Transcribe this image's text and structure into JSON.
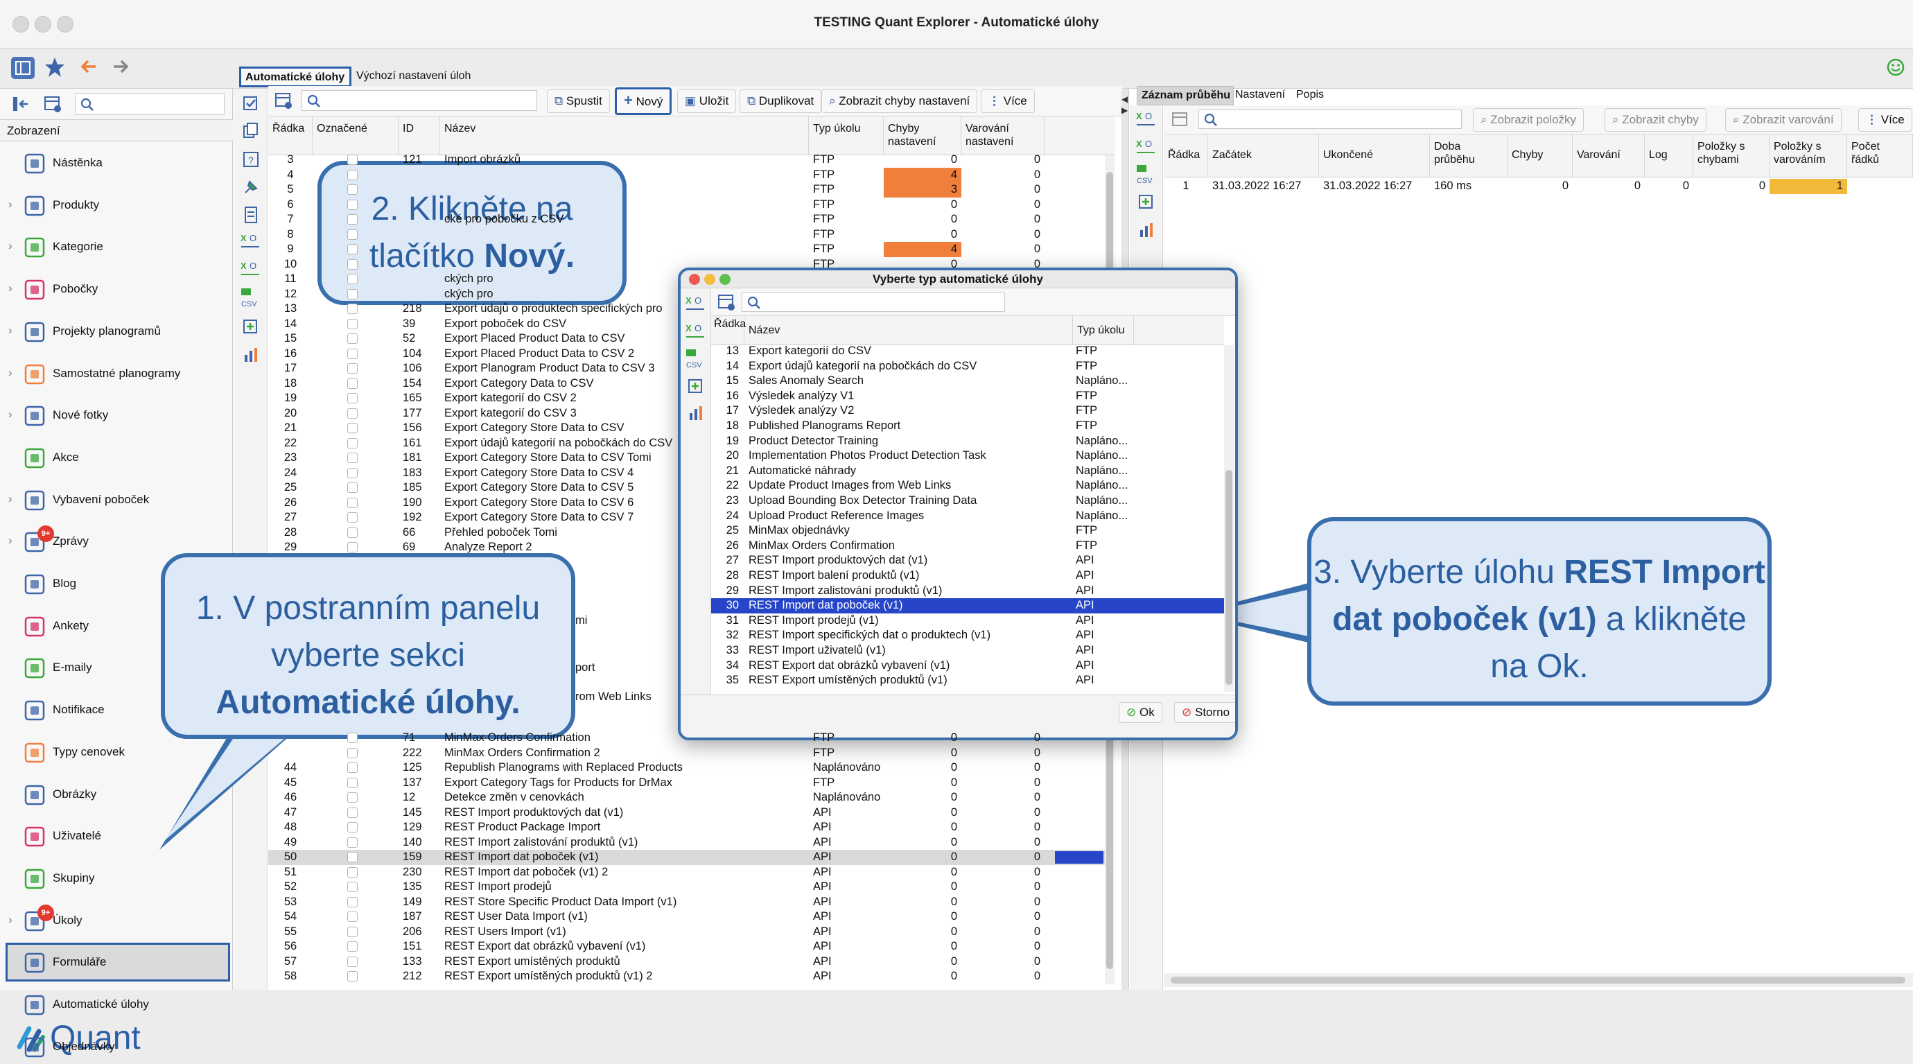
{
  "window": {
    "title": "TESTING Quant Explorer - Automatické úlohy"
  },
  "sidebar": {
    "section_label": "Zobrazení",
    "items": [
      {
        "label": "Nástěnka",
        "icon": "dashboard-icon",
        "chevron": false,
        "badge": ""
      },
      {
        "label": "Produkty",
        "icon": "product-icon",
        "chevron": true,
        "badge": ""
      },
      {
        "label": "Kategorie",
        "icon": "category-icon",
        "chevron": true,
        "badge": ""
      },
      {
        "label": "Pobočky",
        "icon": "store-icon",
        "chevron": true,
        "badge": ""
      },
      {
        "label": "Projekty planogramů",
        "icon": "planogram-project-icon",
        "chevron": true,
        "badge": ""
      },
      {
        "label": "Samostatné planogramy",
        "icon": "planogram-icon",
        "chevron": true,
        "badge": ""
      },
      {
        "label": "Nové fotky",
        "icon": "camera-icon",
        "chevron": true,
        "badge": ""
      },
      {
        "label": "Akce",
        "icon": "promo-icon",
        "chevron": false,
        "badge": ""
      },
      {
        "label": "Vybavení poboček",
        "icon": "equipment-icon",
        "chevron": true,
        "badge": ""
      },
      {
        "label": "Zprávy",
        "icon": "message-icon",
        "chevron": true,
        "badge": "9+"
      },
      {
        "label": "Blog",
        "icon": "blog-icon",
        "chevron": false,
        "badge": ""
      },
      {
        "label": "Ankety",
        "icon": "survey-icon",
        "chevron": false,
        "badge": ""
      },
      {
        "label": "E-maily",
        "icon": "mail-icon",
        "chevron": false,
        "badge": ""
      },
      {
        "label": "Notifikace",
        "icon": "notification-icon",
        "chevron": false,
        "badge": ""
      },
      {
        "label": "Typy cenovek",
        "icon": "price-tag-icon",
        "chevron": false,
        "badge": ""
      },
      {
        "label": "Obrázky",
        "icon": "image-icon",
        "chevron": false,
        "badge": ""
      },
      {
        "label": "Uživatelé",
        "icon": "user-icon",
        "chevron": false,
        "badge": ""
      },
      {
        "label": "Skupiny",
        "icon": "group-icon",
        "chevron": false,
        "badge": ""
      },
      {
        "label": "Úkoly",
        "icon": "task-icon",
        "chevron": true,
        "badge": "9+"
      },
      {
        "label": "Formuláře",
        "icon": "form-icon",
        "chevron": false,
        "badge": ""
      },
      {
        "label": "Automatické úlohy",
        "icon": "automatic-task-icon",
        "chevron": false,
        "badge": ""
      },
      {
        "label": "Objednávky",
        "icon": "order-icon",
        "chevron": false,
        "badge": ""
      }
    ],
    "logo_text": "Quant"
  },
  "main": {
    "tabs": [
      "Automatické úlohy",
      "Výchozí nastavení úloh"
    ],
    "toolbar": {
      "run_label": "Spustit",
      "new_label": "Nový",
      "save_label": "Uložit",
      "duplicate_label": "Duplikovat",
      "show_errors_label": "Zobrazit chyby nastavení",
      "more_label": "Více"
    },
    "columns": [
      "Řádka",
      "Označené",
      "ID",
      "Název",
      "Typ úkolu",
      "Chyby nastavení",
      "Varování nastavení"
    ],
    "rows": [
      {
        "n": "3",
        "id": "121",
        "name": "Import obrázků",
        "type": "FTP",
        "err": "0",
        "warn": "0"
      },
      {
        "n": "4",
        "id": "",
        "name": "",
        "type": "FTP",
        "err": "4",
        "warn": "0"
      },
      {
        "n": "5",
        "id": "",
        "name": "",
        "type": "FTP",
        "err": "3",
        "warn": "0"
      },
      {
        "n": "6",
        "id": "",
        "name": "",
        "type": "FTP",
        "err": "0",
        "warn": "0"
      },
      {
        "n": "7",
        "id": "",
        "name": "cké pro pobočku z CSV",
        "type": "FTP",
        "err": "0",
        "warn": "0"
      },
      {
        "n": "8",
        "id": "",
        "name": "",
        "type": "FTP",
        "err": "0",
        "warn": "0"
      },
      {
        "n": "9",
        "id": "",
        "name": "",
        "type": "FTP",
        "err": "4",
        "warn": "0"
      },
      {
        "n": "10",
        "id": "",
        "name": "",
        "type": "FTP",
        "err": "0",
        "warn": "0"
      },
      {
        "n": "11",
        "id": "",
        "name": "ckých pro",
        "type": "",
        "err": "",
        "warn": ""
      },
      {
        "n": "12",
        "id": "",
        "name": "ckých pro",
        "type": "",
        "err": "",
        "warn": ""
      },
      {
        "n": "13",
        "id": "218",
        "name": "Export údajů o produktech specifických pro",
        "type": "",
        "err": "",
        "warn": ""
      },
      {
        "n": "14",
        "id": "39",
        "name": "Export poboček do CSV",
        "type": "",
        "err": "",
        "warn": ""
      },
      {
        "n": "15",
        "id": "52",
        "name": "Export Placed Product Data to CSV",
        "type": "",
        "err": "",
        "warn": ""
      },
      {
        "n": "16",
        "id": "104",
        "name": "Export Placed Product Data to CSV 2",
        "type": "",
        "err": "",
        "warn": ""
      },
      {
        "n": "17",
        "id": "106",
        "name": "Export Planogram Product Data to CSV 3",
        "type": "",
        "err": "",
        "warn": ""
      },
      {
        "n": "18",
        "id": "154",
        "name": "Export Category Data to CSV",
        "type": "",
        "err": "",
        "warn": ""
      },
      {
        "n": "19",
        "id": "165",
        "name": "Export kategorií do CSV 2",
        "type": "",
        "err": "",
        "warn": ""
      },
      {
        "n": "20",
        "id": "177",
        "name": "Export kategorií do CSV 3",
        "type": "",
        "err": "",
        "warn": ""
      },
      {
        "n": "21",
        "id": "156",
        "name": "Export Category Store Data to CSV",
        "type": "",
        "err": "",
        "warn": ""
      },
      {
        "n": "22",
        "id": "161",
        "name": "Export údajů kategorií na pobočkách do CSV",
        "type": "",
        "err": "",
        "warn": ""
      },
      {
        "n": "23",
        "id": "181",
        "name": "Export Category Store Data to CSV Tomi",
        "type": "",
        "err": "",
        "warn": ""
      },
      {
        "n": "24",
        "id": "183",
        "name": "Export Category Store Data to CSV 4",
        "type": "",
        "err": "",
        "warn": ""
      },
      {
        "n": "25",
        "id": "185",
        "name": "Export Category Store Data to CSV 5",
        "type": "",
        "err": "",
        "warn": ""
      },
      {
        "n": "26",
        "id": "190",
        "name": "Export Category Store Data to CSV 6",
        "type": "",
        "err": "",
        "warn": ""
      },
      {
        "n": "27",
        "id": "192",
        "name": "Export Category Store Data to CSV 7",
        "type": "",
        "err": "",
        "warn": ""
      },
      {
        "n": "28",
        "id": "66",
        "name": "Přehled poboček Tomi",
        "type": "",
        "err": "",
        "warn": ""
      },
      {
        "n": "29",
        "id": "69",
        "name": "Analyze Report 2",
        "type": "",
        "err": "",
        "warn": ""
      }
    ],
    "partial_rows": [
      {
        "name": "mi"
      },
      {
        "name": "port"
      },
      {
        "name": "rom Web Links"
      }
    ],
    "bottom_rows": [
      {
        "n": "",
        "id": "71",
        "name": "MinMax Orders Confirmation",
        "type": "FTP",
        "err": "0",
        "warn": "0"
      },
      {
        "n": "",
        "id": "222",
        "name": "MinMax Orders Confirmation 2",
        "type": "FTP",
        "err": "0",
        "warn": "0"
      },
      {
        "n": "44",
        "id": "125",
        "name": "Republish Planograms with Replaced Products",
        "type": "Naplánováno",
        "err": "0",
        "warn": "0"
      },
      {
        "n": "45",
        "id": "137",
        "name": "Export Category Tags for Products for DrMax",
        "type": "FTP",
        "err": "0",
        "warn": "0"
      },
      {
        "n": "46",
        "id": "12",
        "name": "Detekce změn v cenovkách",
        "type": "Naplánováno",
        "err": "0",
        "warn": "0"
      },
      {
        "n": "47",
        "id": "145",
        "name": "REST Import produktových dat (v1)",
        "type": "API",
        "err": "0",
        "warn": "0"
      },
      {
        "n": "48",
        "id": "129",
        "name": "REST Product Package Import",
        "type": "API",
        "err": "0",
        "warn": "0"
      },
      {
        "n": "49",
        "id": "140",
        "name": "REST Import zalistování produktů (v1)",
        "type": "API",
        "err": "0",
        "warn": "0"
      },
      {
        "n": "50",
        "id": "159",
        "name": "REST Import dat poboček (v1)",
        "type": "API",
        "err": "0",
        "warn": "0"
      },
      {
        "n": "51",
        "id": "230",
        "name": "REST Import dat poboček (v1) 2",
        "type": "API",
        "err": "0",
        "warn": "0"
      },
      {
        "n": "52",
        "id": "135",
        "name": "REST Import prodejů",
        "type": "API",
        "err": "0",
        "warn": "0"
      },
      {
        "n": "53",
        "id": "149",
        "name": "REST Store Specific Product Data Import (v1)",
        "type": "API",
        "err": "0",
        "warn": "0"
      },
      {
        "n": "54",
        "id": "187",
        "name": "REST User Data Import (v1)",
        "type": "API",
        "err": "0",
        "warn": "0"
      },
      {
        "n": "55",
        "id": "206",
        "name": "REST Users Import (v1)",
        "type": "API",
        "err": "0",
        "warn": "0"
      },
      {
        "n": "56",
        "id": "151",
        "name": "REST Export dat obrázků vybavení (v1)",
        "type": "API",
        "err": "0",
        "warn": "0"
      },
      {
        "n": "57",
        "id": "133",
        "name": "REST Export umístěných produktů",
        "type": "API",
        "err": "0",
        "warn": "0"
      },
      {
        "n": "58",
        "id": "212",
        "name": "REST Export umístěných produktů (v1) 2",
        "type": "API",
        "err": "0",
        "warn": "0"
      }
    ]
  },
  "right_panel": {
    "tabs": [
      "Záznam průběhu",
      "Nastavení",
      "Popis"
    ],
    "toolbar": {
      "show_items_label": "Zobrazit položky",
      "show_errors_label": "Zobrazit chyby",
      "show_warnings_label": "Zobrazit varování",
      "more_label": "Více"
    },
    "columns": [
      "Řádka",
      "Začátek",
      "Ukončené",
      "Doba průběhu",
      "Chyby",
      "Varování",
      "Log",
      "Položky s chybami",
      "Položky s varováním",
      "Počet řádků"
    ],
    "rows": [
      {
        "n": "1",
        "start": "31.03.2022 16:27",
        "end": "31.03.2022 16:27",
        "duration": "160 ms",
        "errors": "0",
        "warnings": "0",
        "log": "0",
        "items_err": "0",
        "items_warn": "1",
        "count": ""
      }
    ]
  },
  "dialog": {
    "title": "Vyberte typ automatické úlohy",
    "columns": [
      "Řádka",
      "Název",
      "Typ úkolu"
    ],
    "rows": [
      {
        "n": "13",
        "name": "Export kategorií do CSV",
        "type": "FTP"
      },
      {
        "n": "14",
        "name": "Export údajů kategorií na pobočkách do CSV",
        "type": "FTP"
      },
      {
        "n": "15",
        "name": "Sales Anomaly Search",
        "type": "Naplánо..."
      },
      {
        "n": "16",
        "name": "Výsledek analýzy V1",
        "type": "FTP"
      },
      {
        "n": "17",
        "name": "Výsledek analýzy V2",
        "type": "FTP"
      },
      {
        "n": "18",
        "name": "Published Planograms Report",
        "type": "FTP"
      },
      {
        "n": "19",
        "name": "Product Detector Training",
        "type": "Naplánо..."
      },
      {
        "n": "20",
        "name": "Implementation Photos Product Detection Task",
        "type": "Naplánо..."
      },
      {
        "n": "21",
        "name": "Automatické náhrady",
        "type": "Naplánо..."
      },
      {
        "n": "22",
        "name": "Update Product Images from Web Links",
        "type": "Naplánо..."
      },
      {
        "n": "23",
        "name": "Upload Bounding Box Detector Training Data",
        "type": "Naplánо..."
      },
      {
        "n": "24",
        "name": "Upload Product Reference Images",
        "type": "Naplánо..."
      },
      {
        "n": "25",
        "name": "MinMax objednávky",
        "type": "FTP"
      },
      {
        "n": "26",
        "name": "MinMax Orders Confirmation",
        "type": "FTP"
      },
      {
        "n": "27",
        "name": "REST Import produktových dat (v1)",
        "type": "API"
      },
      {
        "n": "28",
        "name": "REST Import balení produktů (v1)",
        "type": "API"
      },
      {
        "n": "29",
        "name": "REST Import zalistování produktů (v1)",
        "type": "API"
      },
      {
        "n": "30",
        "name": "REST Import dat poboček (v1)",
        "type": "API"
      },
      {
        "n": "31",
        "name": "REST Import prodejů (v1)",
        "type": "API"
      },
      {
        "n": "32",
        "name": "REST Import specifických dat o produktech (v1)",
        "type": "API"
      },
      {
        "n": "33",
        "name": "REST Import uživatelů (v1)",
        "type": "API"
      },
      {
        "n": "34",
        "name": "REST Export dat obrázků vybavení (v1)",
        "type": "API"
      },
      {
        "n": "35",
        "name": "REST Export umístěných produktů (v1)",
        "type": "API"
      }
    ],
    "ok_label": "Ok",
    "cancel_label": "Storno"
  },
  "callouts": {
    "step1_pre": "1. V postranním panelu vyberte sekci",
    "step1_bold": "Automatické úlohy.",
    "step2_pre": "2. Klikněte na tlačítko",
    "step2_bold": "Nový.",
    "step3_pre": "3. Vyberte úlohu",
    "step3_bold": "REST Import dat poboček (v1)",
    "step3_post": "a klikněte na Ok."
  },
  "colors": {
    "accent": "#3a6fae",
    "selection": "#2645c9",
    "error_cell": "#f07f3c",
    "warning_cell": "#f3b93a",
    "callout_fill": "#dde9f6",
    "callout_text": "#2c5fa0"
  }
}
